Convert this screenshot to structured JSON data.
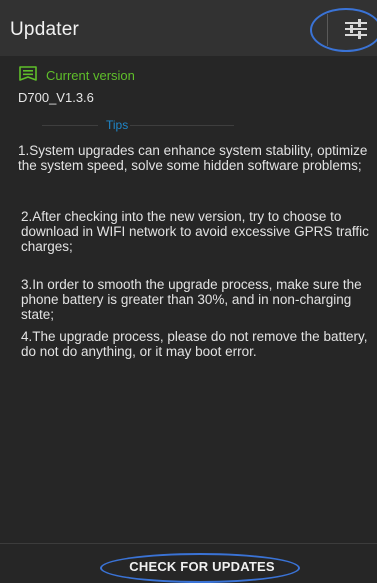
{
  "header": {
    "title": "Updater",
    "settings_icon": "sliders-icon"
  },
  "current_version": {
    "icon": "flag-icon",
    "label": "Current version",
    "value": "D700_V1.3.6"
  },
  "tips": {
    "label": "Tips",
    "items": [
      "1.System upgrades can enhance system stability, optimize the system speed, solve some hidden software problems;",
      "2.After checking into the new version, try to choose to download in WIFI network to avoid excessive GPRS traffic charges;",
      "3.In order to smooth the upgrade process, make sure the phone battery is greater than 30%, and in non-charging state;",
      "4.The upgrade process, please do not remove the battery, do not do anything, or it may boot error."
    ]
  },
  "footer": {
    "check_button_label": "CHECK FOR UPDATES"
  },
  "colors": {
    "background": "#262626",
    "app_bar": "#323232",
    "version_accent": "#5fbf2a",
    "tips_accent": "#1f86c8",
    "annotation": "#3a73d6"
  }
}
